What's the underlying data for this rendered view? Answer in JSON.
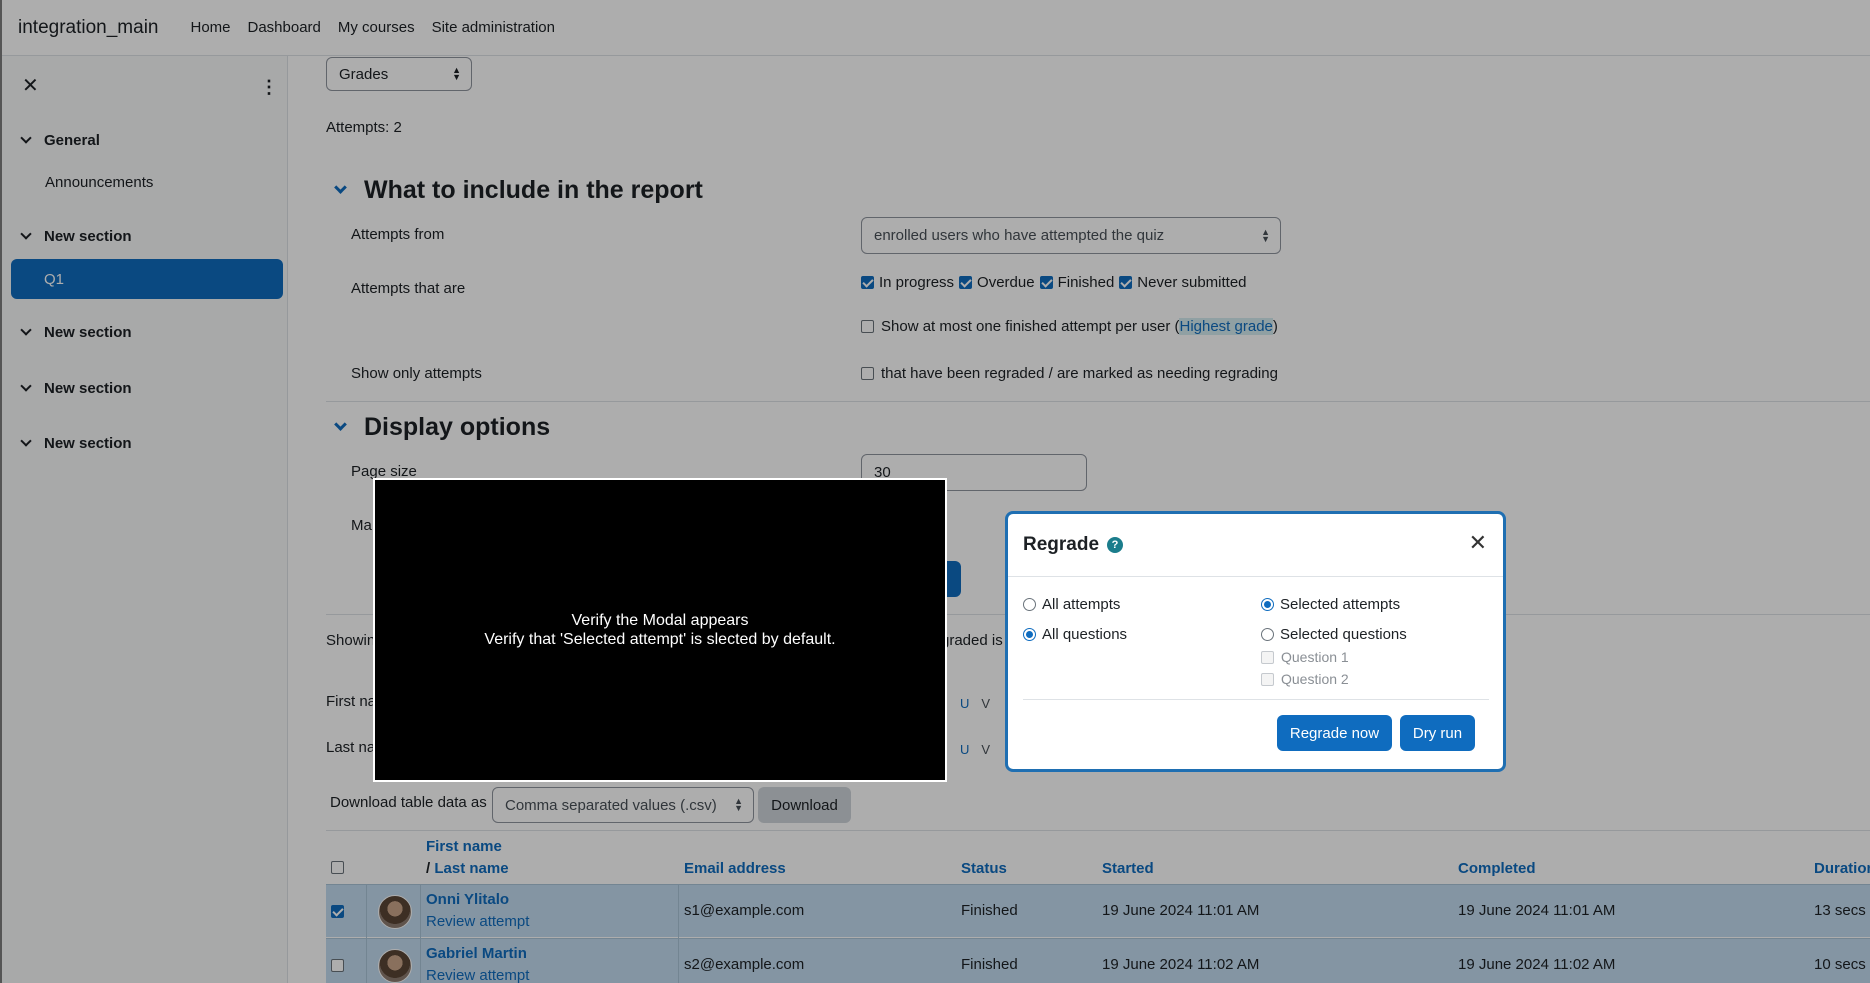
{
  "navbar": {
    "brand": "integration_main",
    "links": [
      "Home",
      "Dashboard",
      "My courses",
      "Site administration"
    ]
  },
  "drawer": {
    "close_icon": "close-icon",
    "menu_icon": "kebab-icon",
    "sections": [
      {
        "label": "General",
        "items": [
          "Announcements"
        ]
      },
      {
        "label": "New section",
        "items": [
          "Q1"
        ]
      },
      {
        "label": "New section",
        "items": []
      },
      {
        "label": "New section",
        "items": []
      },
      {
        "label": "New section",
        "items": []
      }
    ],
    "active_item": "Q1"
  },
  "report": {
    "view_select": "Grades",
    "attempts_count": "Attempts: 2",
    "include_heading": "What to include in the report",
    "attempts_from_label": "Attempts from",
    "attempts_from_value": "enrolled users who have attempted the quiz",
    "attempts_that_are_label": "Attempts that are",
    "states": [
      {
        "label": "In progress",
        "checked": true
      },
      {
        "label": "Overdue",
        "checked": true
      },
      {
        "label": "Finished",
        "checked": true
      },
      {
        "label": "Never submitted",
        "checked": true
      }
    ],
    "one_attempt_prefix": "Show at most one finished attempt per user (",
    "one_attempt_link": "Highest grade",
    "one_attempt_suffix": ")",
    "show_only_label": "Show only attempts",
    "show_only_option": "that have been regraded / are marked as needing regrading",
    "display_heading": "Display options",
    "page_size_label": "Page size",
    "page_size_value": "30",
    "marks_label_fragment": "Ma",
    "showing_fragment": "Showin",
    "regraded_fragment": "graded is",
    "first_name_fragment": "First na",
    "last_name_fragment": "Last na",
    "initials_row1": [
      "U",
      "V"
    ],
    "initials_row2": [
      "U",
      "V"
    ],
    "download_label": "Download table data as",
    "download_format": "Comma separated values (.csv)",
    "download_button": "Download"
  },
  "table": {
    "headers": {
      "first_name": "First name",
      "last_name_prefix": "/ ",
      "last_name": "Last name",
      "email": "Email address",
      "status": "Status",
      "started": "Started",
      "completed": "Completed",
      "duration": "Duration"
    },
    "rows": [
      {
        "name": "Onni Ylitalo",
        "review": "Review attempt",
        "email": "s1@example.com",
        "status": "Finished",
        "started": "19 June 2024 11:01 AM",
        "completed": "19 June 2024 11:01 AM",
        "duration": "13 secs",
        "checked": true
      },
      {
        "name": "Gabriel Martin",
        "review": "Review attempt",
        "email": "s2@example.com",
        "status": "Finished",
        "started": "19 June 2024 11:02 AM",
        "completed": "19 June 2024 11:02 AM",
        "duration": "10 secs",
        "checked": false
      }
    ]
  },
  "modal": {
    "title": "Regrade",
    "help_icon": "help-icon",
    "close_icon": "close-icon",
    "all_attempts": "All attempts",
    "selected_attempts": "Selected attempts",
    "all_questions": "All questions",
    "selected_questions": "Selected questions",
    "question_1": "Question 1",
    "question_2": "Question 2",
    "regrade_now": "Regrade now",
    "dry_run": "Dry run"
  },
  "video_caption": {
    "line1": "Verify the Modal appears",
    "line2": "Verify that 'Selected attempt' is slected by default."
  },
  "colors": {
    "primary": "#0f6cbf",
    "row_highlight": "#c3dcf0",
    "help_teal": "#1b7d8c"
  }
}
